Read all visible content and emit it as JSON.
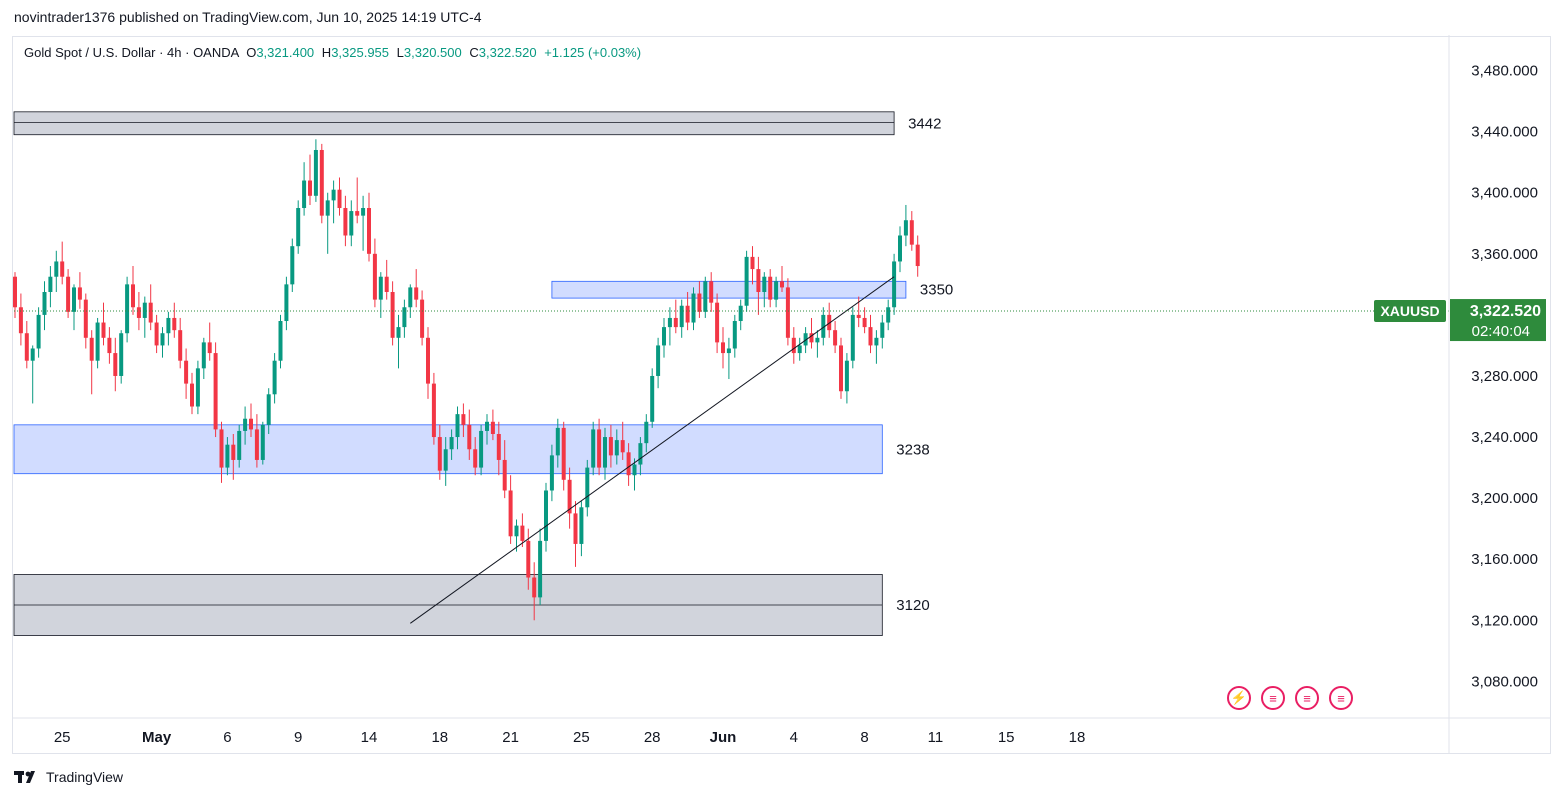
{
  "header": {
    "published": "novintrader1376 published on TradingView.com, Jun 10, 2025 14:19 UTC-4"
  },
  "legend": {
    "symbol": "Gold Spot / U.S. Dollar · 4h · OANDA",
    "o_label": "O",
    "o": "3,321.400",
    "h_label": "H",
    "h": "3,325.955",
    "l_label": "L",
    "l": "3,320.500",
    "c_label": "C",
    "c": "3,322.520",
    "change": "+1.125 (+0.03%)"
  },
  "footer": {
    "brand": "TradingView"
  },
  "colors": {
    "up": "#089981",
    "down": "#f23645",
    "zone_blue_fill": "#d1dcff",
    "zone_blue_stroke": "#2962ff",
    "zone_gray_fill": "#d1d4dc",
    "zone_gray_stroke": "#131722",
    "price_tag": "#2e8b3c"
  },
  "events": {
    "icons": [
      "lightning-flag-icon",
      "us-flag-icon",
      "us-flag-icon",
      "us-flag-icon"
    ]
  },
  "chart_data": {
    "type": "candlestick",
    "interval": "4h",
    "ylim": [
      3056,
      3502
    ],
    "y_ticks": [
      3080,
      3120,
      3160,
      3200,
      3240,
      3280,
      3320,
      3360,
      3400,
      3440,
      3480
    ],
    "y_tick_labels": [
      "3,080.000",
      "3,120.000",
      "3,160.000",
      "3,200.000",
      "3,240.000",
      "3,280.000",
      "3,320.000",
      "3,360.000",
      "3,400.000",
      "3,440.000",
      "3,480.000"
    ],
    "x_ticks": [
      {
        "label": "25",
        "bar": 8
      },
      {
        "label": "May",
        "bar": 24
      },
      {
        "label": "6",
        "bar": 36
      },
      {
        "label": "9",
        "bar": 48
      },
      {
        "label": "14",
        "bar": 60
      },
      {
        "label": "18",
        "bar": 72
      },
      {
        "label": "21",
        "bar": 84
      },
      {
        "label": "25",
        "bar": 96
      },
      {
        "label": "28",
        "bar": 108
      },
      {
        "label": "Jun",
        "bar": 120
      },
      {
        "label": "4",
        "bar": 132
      },
      {
        "label": "8",
        "bar": 144
      },
      {
        "label": "11",
        "bar": 156
      },
      {
        "label": "15",
        "bar": 168
      },
      {
        "label": "18",
        "bar": 180
      }
    ],
    "last_price": "3,322.520",
    "countdown": "02:40:04",
    "symbol_tag": "XAUUSD",
    "zones": [
      {
        "label": "3442",
        "top": 3453,
        "bottom": 3438,
        "mid": 3446,
        "style": "gray",
        "end_bar": 149
      },
      {
        "label": "3350",
        "top": 3342,
        "bottom": 3331,
        "style": "blue",
        "start_bar": 91,
        "end_bar": 151
      },
      {
        "label": "3238",
        "top": 3248,
        "bottom": 3216,
        "style": "blue",
        "end_bar": 147
      },
      {
        "label": "3120",
        "top": 3150,
        "bottom": 3110,
        "mid": 3130,
        "style": "gray",
        "end_bar": 147
      }
    ],
    "trendline": {
      "from_bar": 67,
      "from_price": 3118,
      "to_bar": 149,
      "to_price": 3345
    },
    "candles": [
      [
        3345,
        3348,
        3318,
        3325
      ],
      [
        3325,
        3334,
        3300,
        3308
      ],
      [
        3308,
        3316,
        3285,
        3290
      ],
      [
        3290,
        3300,
        3262,
        3298
      ],
      [
        3298,
        3325,
        3292,
        3320
      ],
      [
        3320,
        3342,
        3310,
        3335
      ],
      [
        3335,
        3352,
        3325,
        3345
      ],
      [
        3345,
        3362,
        3335,
        3355
      ],
      [
        3355,
        3368,
        3340,
        3345
      ],
      [
        3345,
        3350,
        3318,
        3322
      ],
      [
        3322,
        3340,
        3310,
        3338
      ],
      [
        3338,
        3348,
        3324,
        3330
      ],
      [
        3330,
        3334,
        3298,
        3305
      ],
      [
        3305,
        3310,
        3268,
        3290
      ],
      [
        3290,
        3318,
        3285,
        3315
      ],
      [
        3315,
        3328,
        3300,
        3305
      ],
      [
        3305,
        3312,
        3288,
        3295
      ],
      [
        3295,
        3305,
        3270,
        3280
      ],
      [
        3280,
        3310,
        3275,
        3308
      ],
      [
        3308,
        3345,
        3302,
        3340
      ],
      [
        3340,
        3352,
        3320,
        3325
      ],
      [
        3325,
        3335,
        3310,
        3318
      ],
      [
        3318,
        3332,
        3305,
        3328
      ],
      [
        3328,
        3340,
        3310,
        3315
      ],
      [
        3315,
        3320,
        3295,
        3300
      ],
      [
        3300,
        3312,
        3292,
        3308
      ],
      [
        3308,
        3322,
        3300,
        3318
      ],
      [
        3318,
        3328,
        3305,
        3310
      ],
      [
        3310,
        3318,
        3285,
        3290
      ],
      [
        3290,
        3298,
        3265,
        3275
      ],
      [
        3275,
        3282,
        3255,
        3260
      ],
      [
        3260,
        3290,
        3255,
        3285
      ],
      [
        3285,
        3305,
        3278,
        3302
      ],
      [
        3302,
        3315,
        3290,
        3295
      ],
      [
        3295,
        3302,
        3240,
        3245
      ],
      [
        3245,
        3250,
        3210,
        3220
      ],
      [
        3220,
        3240,
        3215,
        3235
      ],
      [
        3235,
        3242,
        3212,
        3225
      ],
      [
        3225,
        3248,
        3220,
        3244
      ],
      [
        3244,
        3260,
        3235,
        3252
      ],
      [
        3252,
        3262,
        3240,
        3245
      ],
      [
        3245,
        3255,
        3220,
        3225
      ],
      [
        3225,
        3250,
        3222,
        3248
      ],
      [
        3248,
        3272,
        3242,
        3268
      ],
      [
        3268,
        3295,
        3262,
        3290
      ],
      [
        3290,
        3320,
        3285,
        3316
      ],
      [
        3316,
        3345,
        3310,
        3340
      ],
      [
        3340,
        3370,
        3335,
        3365
      ],
      [
        3365,
        3395,
        3360,
        3390
      ],
      [
        3390,
        3420,
        3385,
        3408
      ],
      [
        3408,
        3425,
        3392,
        3398
      ],
      [
        3398,
        3435,
        3394,
        3428
      ],
      [
        3428,
        3432,
        3380,
        3385
      ],
      [
        3385,
        3400,
        3360,
        3395
      ],
      [
        3395,
        3408,
        3380,
        3402
      ],
      [
        3402,
        3410,
        3385,
        3390
      ],
      [
        3390,
        3398,
        3365,
        3372
      ],
      [
        3372,
        3395,
        3365,
        3388
      ],
      [
        3388,
        3410,
        3380,
        3385
      ],
      [
        3385,
        3398,
        3362,
        3390
      ],
      [
        3390,
        3400,
        3355,
        3360
      ],
      [
        3360,
        3370,
        3325,
        3330
      ],
      [
        3330,
        3348,
        3318,
        3345
      ],
      [
        3345,
        3356,
        3330,
        3335
      ],
      [
        3335,
        3342,
        3300,
        3305
      ],
      [
        3305,
        3320,
        3285,
        3312
      ],
      [
        3312,
        3330,
        3305,
        3325
      ],
      [
        3325,
        3340,
        3318,
        3338
      ],
      [
        3338,
        3350,
        3325,
        3330
      ],
      [
        3330,
        3336,
        3300,
        3305
      ],
      [
        3305,
        3312,
        3265,
        3275
      ],
      [
        3275,
        3282,
        3235,
        3240
      ],
      [
        3240,
        3248,
        3212,
        3218
      ],
      [
        3218,
        3240,
        3208,
        3232
      ],
      [
        3232,
        3245,
        3225,
        3240
      ],
      [
        3240,
        3260,
        3232,
        3255
      ],
      [
        3255,
        3262,
        3240,
        3248
      ],
      [
        3248,
        3258,
        3225,
        3232
      ],
      [
        3232,
        3240,
        3215,
        3220
      ],
      [
        3220,
        3248,
        3215,
        3244
      ],
      [
        3244,
        3255,
        3235,
        3250
      ],
      [
        3250,
        3258,
        3238,
        3242
      ],
      [
        3242,
        3250,
        3215,
        3225
      ],
      [
        3225,
        3238,
        3200,
        3205
      ],
      [
        3205,
        3215,
        3170,
        3175
      ],
      [
        3175,
        3186,
        3165,
        3182
      ],
      [
        3182,
        3190,
        3168,
        3172
      ],
      [
        3172,
        3180,
        3140,
        3148
      ],
      [
        3148,
        3158,
        3120,
        3135
      ],
      [
        3135,
        3180,
        3130,
        3172
      ],
      [
        3172,
        3210,
        3165,
        3205
      ],
      [
        3205,
        3235,
        3198,
        3228
      ],
      [
        3228,
        3252,
        3220,
        3246
      ],
      [
        3246,
        3250,
        3205,
        3212
      ],
      [
        3212,
        3220,
        3180,
        3190
      ],
      [
        3190,
        3198,
        3155,
        3170
      ],
      [
        3170,
        3198,
        3162,
        3194
      ],
      [
        3194,
        3225,
        3188,
        3220
      ],
      [
        3220,
        3250,
        3215,
        3245
      ],
      [
        3245,
        3252,
        3215,
        3220
      ],
      [
        3220,
        3246,
        3212,
        3240
      ],
      [
        3240,
        3248,
        3220,
        3228
      ],
      [
        3228,
        3245,
        3222,
        3238
      ],
      [
        3238,
        3250,
        3225,
        3230
      ],
      [
        3230,
        3236,
        3208,
        3215
      ],
      [
        3215,
        3226,
        3205,
        3222
      ],
      [
        3222,
        3240,
        3215,
        3236
      ],
      [
        3236,
        3255,
        3230,
        3250
      ],
      [
        3250,
        3285,
        3246,
        3280
      ],
      [
        3280,
        3305,
        3272,
        3300
      ],
      [
        3300,
        3318,
        3292,
        3312
      ],
      [
        3312,
        3325,
        3300,
        3318
      ],
      [
        3318,
        3330,
        3308,
        3312
      ],
      [
        3312,
        3330,
        3305,
        3326
      ],
      [
        3326,
        3335,
        3310,
        3315
      ],
      [
        3315,
        3338,
        3310,
        3334
      ],
      [
        3334,
        3342,
        3318,
        3322
      ],
      [
        3322,
        3345,
        3318,
        3342
      ],
      [
        3342,
        3348,
        3322,
        3328
      ],
      [
        3328,
        3334,
        3295,
        3302
      ],
      [
        3302,
        3312,
        3285,
        3295
      ],
      [
        3295,
        3305,
        3278,
        3298
      ],
      [
        3298,
        3320,
        3292,
        3316
      ],
      [
        3316,
        3330,
        3310,
        3326
      ],
      [
        3326,
        3362,
        3322,
        3358
      ],
      [
        3358,
        3365,
        3340,
        3350
      ],
      [
        3350,
        3358,
        3320,
        3335
      ],
      [
        3335,
        3348,
        3325,
        3345
      ],
      [
        3345,
        3350,
        3325,
        3330
      ],
      [
        3330,
        3345,
        3325,
        3342
      ],
      [
        3342,
        3352,
        3335,
        3338
      ],
      [
        3338,
        3344,
        3300,
        3305
      ],
      [
        3305,
        3312,
        3288,
        3295
      ],
      [
        3295,
        3305,
        3290,
        3300
      ],
      [
        3300,
        3312,
        3295,
        3308
      ],
      [
        3308,
        3318,
        3298,
        3302
      ],
      [
        3302,
        3310,
        3292,
        3305
      ],
      [
        3305,
        3325,
        3300,
        3320
      ],
      [
        3320,
        3328,
        3305,
        3310
      ],
      [
        3310,
        3316,
        3295,
        3300
      ],
      [
        3300,
        3305,
        3265,
        3270
      ],
      [
        3270,
        3295,
        3262,
        3290
      ],
      [
        3290,
        3325,
        3285,
        3320
      ],
      [
        3320,
        3332,
        3312,
        3318
      ],
      [
        3318,
        3325,
        3308,
        3312
      ],
      [
        3312,
        3320,
        3295,
        3300
      ],
      [
        3300,
        3310,
        3288,
        3305
      ],
      [
        3305,
        3320,
        3298,
        3315
      ],
      [
        3315,
        3330,
        3310,
        3325
      ],
      [
        3325,
        3360,
        3320,
        3355
      ],
      [
        3355,
        3378,
        3348,
        3372
      ],
      [
        3372,
        3392,
        3365,
        3382
      ],
      [
        3382,
        3388,
        3362,
        3366
      ],
      [
        3366,
        3372,
        3345,
        3352
      ]
    ]
  }
}
